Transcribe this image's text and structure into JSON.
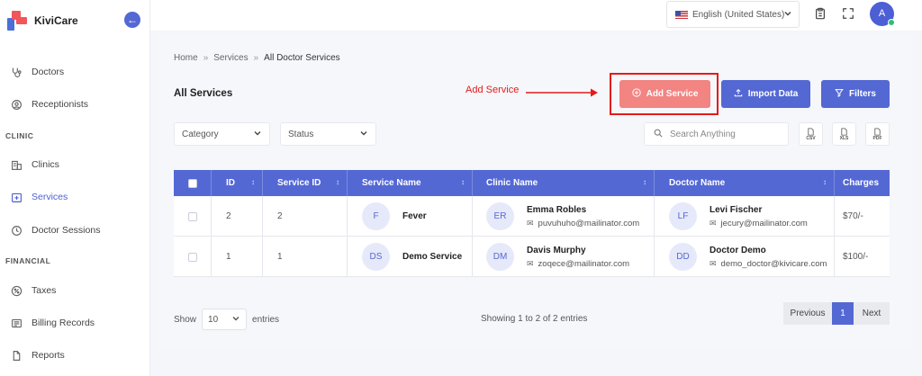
{
  "app": {
    "name": "KiviCare"
  },
  "sidebar": {
    "items": [
      {
        "label": "Doctors",
        "icon": "stethoscope-icon"
      },
      {
        "label": "Receptionists",
        "icon": "receptionist-icon"
      },
      {
        "label": "Clinics",
        "icon": "building-icon"
      },
      {
        "label": "Services",
        "icon": "medical-box-icon",
        "active": true
      },
      {
        "label": "Doctor Sessions",
        "icon": "clock-icon"
      },
      {
        "label": "Taxes",
        "icon": "percent-icon"
      },
      {
        "label": "Billing Records",
        "icon": "bill-icon"
      },
      {
        "label": "Reports",
        "icon": "file-icon"
      }
    ],
    "sections": {
      "clinic": "CLINIC",
      "financial": "FINANCIAL"
    }
  },
  "topbar": {
    "language": "English (United States)",
    "avatar_initial": "A"
  },
  "breadcrumb": {
    "home": "Home",
    "services": "Services",
    "current": "All Doctor Services"
  },
  "page": {
    "title": "All Services"
  },
  "annotation": {
    "label": "Add Service",
    "color": "#e31b1b"
  },
  "buttons": {
    "add_service": "Add Service",
    "import_data": "Import Data",
    "filters": "Filters"
  },
  "filters": {
    "category": "Category",
    "status": "Status",
    "search_placeholder": "Search Anything"
  },
  "exports": {
    "csv": "CSV",
    "xls": "XLS",
    "pdf": "PDF"
  },
  "table": {
    "headers": {
      "id": "ID",
      "service_id": "Service ID",
      "service_name": "Service Name",
      "clinic_name": "Clinic Name",
      "doctor_name": "Doctor Name",
      "charges": "Charges"
    },
    "rows": [
      {
        "id": "2",
        "service_id": "2",
        "service_initials": "F",
        "service_name": "Fever",
        "clinic_initials": "ER",
        "clinic_name": "Emma Robles",
        "clinic_email": "puvuhuho@mailinator.com",
        "doctor_initials": "LF",
        "doctor_name": "Levi Fischer",
        "doctor_email": "jecury@mailinator.com",
        "charges": "$70/-"
      },
      {
        "id": "1",
        "service_id": "1",
        "service_initials": "DS",
        "service_name": "Demo Service",
        "clinic_initials": "DM",
        "clinic_name": "Davis Murphy",
        "clinic_email": "zoqece@mailinator.com",
        "doctor_initials": "DD",
        "doctor_name": "Doctor Demo",
        "doctor_email": "demo_doctor@kivicare.com",
        "charges": "$100/-"
      }
    ]
  },
  "footer": {
    "show": "Show",
    "page_size": "10",
    "entries": "entries",
    "showing": "Showing 1 to 2 of 2 entries",
    "previous": "Previous",
    "current_page": "1",
    "next": "Next"
  },
  "colors": {
    "primary": "#5468d4",
    "add_button": "#f28482",
    "annotation": "#e31b1b"
  }
}
